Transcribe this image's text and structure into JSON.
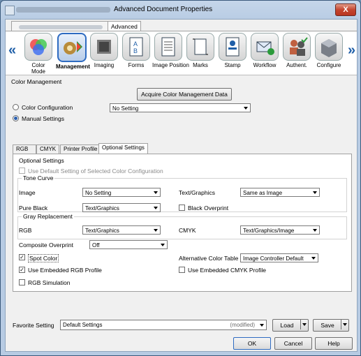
{
  "window": {
    "title": "Advanced Document Properties",
    "close": "X"
  },
  "top_tabs": {
    "advanced": "Advanced"
  },
  "functions": [
    {
      "name": "color-mode",
      "label": "Color\nMode",
      "icon": "color-mode-icon"
    },
    {
      "name": "management",
      "label": "Management",
      "icon": "management-icon",
      "selected": true
    },
    {
      "name": "imaging",
      "label": "Imaging",
      "icon": "imaging-icon"
    },
    {
      "name": "forms",
      "label": "Forms",
      "icon": "forms-icon"
    },
    {
      "name": "image-position",
      "label": "Image Position",
      "icon": "image-position-icon"
    },
    {
      "name": "marks",
      "label": "Marks",
      "icon": "marks-icon"
    },
    {
      "name": "stamp",
      "label": "Stamp",
      "icon": "stamp-icon"
    },
    {
      "name": "workflow",
      "label": "Workflow",
      "icon": "workflow-icon"
    },
    {
      "name": "authent",
      "label": "Authent.",
      "icon": "authent-icon"
    },
    {
      "name": "configure",
      "label": "Configure",
      "icon": "configure-icon"
    }
  ],
  "color_management": {
    "heading": "Color Management",
    "acquire_button": "Acquire Color Management Data",
    "color_configuration_label": "Color Configuration",
    "color_configuration_value": "No Setting",
    "manual_settings_label": "Manual Settings"
  },
  "sub_tabs": [
    "RGB",
    "CMYK",
    "Printer Profile",
    "Optional Settings"
  ],
  "optional": {
    "heading": "Optional Settings",
    "use_default": "Use Default Setting of Selected Color Configuration",
    "tone_curve": "Tone Curve",
    "image_label": "Image",
    "image_value": "No Setting",
    "text_graphics_label": "Text/Graphics",
    "text_graphics_value": "Same as Image",
    "pure_black_label": "Pure Black",
    "pure_black_value": "Text/Graphics",
    "black_overprint": "Black Overprint",
    "gray_replacement": "Gray Replacement",
    "rgb_label": "RGB",
    "rgb_value": "Text/Graphics",
    "cmyk_label": "CMYK",
    "cmyk_value": "Text/Graphics/Image",
    "composite_overprint_label": "Composite Overprint",
    "composite_overprint_value": "Off",
    "spot_color": "Spot Color",
    "alt_color_table_label": "Alternative Color Table",
    "alt_color_table_value": "Image Controller Default",
    "use_embedded_rgb": "Use Embedded RGB Profile",
    "use_embedded_cmyk": "Use Embedded CMYK Profile",
    "rgb_simulation": "RGB Simulation"
  },
  "bottom": {
    "favorite_label": "Favorite Setting",
    "favorite_value": "Default Settings",
    "modified": "(modified)",
    "load": "Load",
    "save": "Save",
    "ok": "OK",
    "cancel": "Cancel",
    "help": "Help"
  },
  "colors": {
    "accent": "#2e6bc1",
    "arrow": "#1f5fa8"
  }
}
